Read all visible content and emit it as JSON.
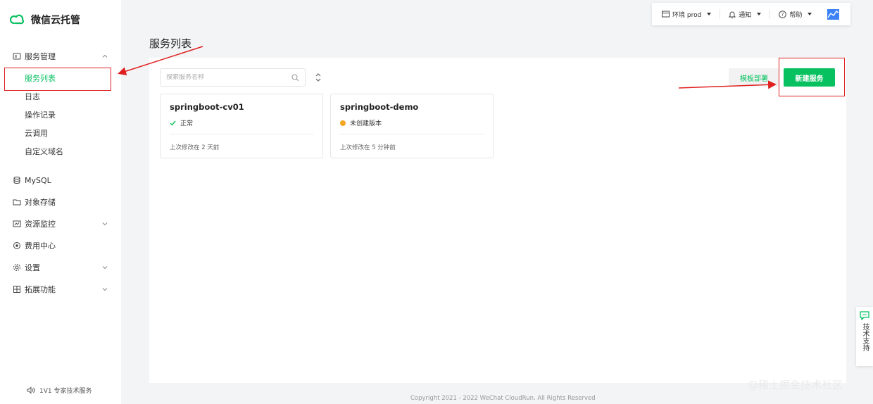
{
  "app": {
    "title": "微信云托管"
  },
  "sidebar": {
    "groups": [
      {
        "label": "服务管理",
        "icon": "server-icon"
      },
      {
        "label": "MySQL",
        "icon": "database-icon"
      },
      {
        "label": "对象存储",
        "icon": "folder-icon"
      },
      {
        "label": "资源监控",
        "icon": "monitor-icon"
      },
      {
        "label": "费用中心",
        "icon": "billing-icon"
      },
      {
        "label": "设置",
        "icon": "gear-icon"
      },
      {
        "label": "拓展功能",
        "icon": "grid-icon"
      }
    ],
    "sub_items": [
      "服务列表",
      "日志",
      "操作记录",
      "云调用",
      "自定义域名"
    ],
    "expert": "1V1 专家技术服务"
  },
  "topbar": {
    "env": "环境 prod",
    "notify": "通知",
    "help": "帮助"
  },
  "page": {
    "title": "服务列表"
  },
  "search": {
    "placeholder": "搜索服务名称"
  },
  "actions": {
    "template": "模板部署",
    "new": "新建服务"
  },
  "services": [
    {
      "name": "springboot-cv01",
      "status": "正常",
      "updated": "上次修改在 2 天前"
    },
    {
      "name": "springboot-demo",
      "status": "未创建版本",
      "updated": "上次修改在 5 分钟前"
    }
  ],
  "footer": "Copyright 2021 - 2022 WeChat CloudRun. All Rights Reserved",
  "support": "技术支持",
  "watermark": "@稀土掘金技术社区",
  "colors": {
    "brand": "#07c160",
    "annotation": "#e02020",
    "warning": "#f5a623"
  }
}
